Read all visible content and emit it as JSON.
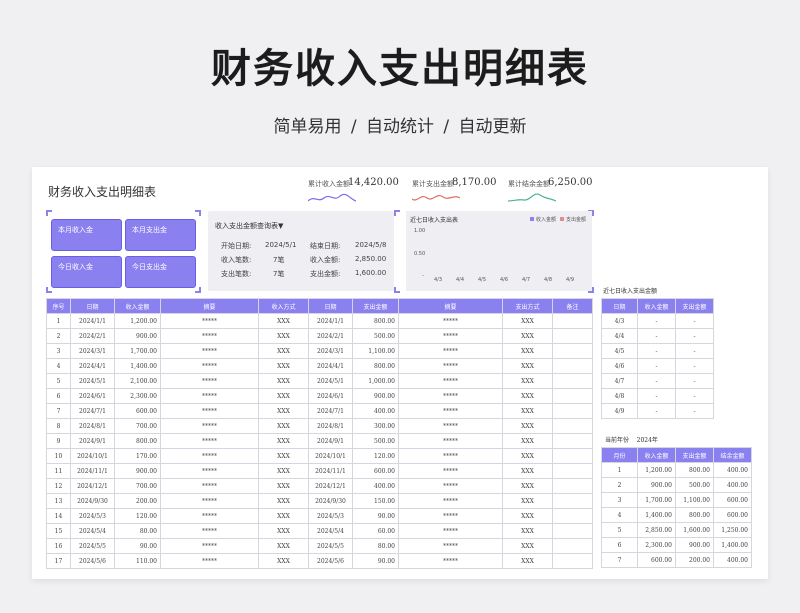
{
  "banner": {
    "title": "财务收入支出明细表",
    "subtitle": "简单易用  /  自动统计  /  自动更新"
  },
  "sheet": {
    "title": "财务收入支出明细表"
  },
  "stats": [
    {
      "label": "累计收入金额",
      "value": "14,420.00",
      "color": "#7c6ee6"
    },
    {
      "label": "累计支出金额",
      "value": "8,170.00",
      "color": "#e0706a"
    },
    {
      "label": "累计结余金额",
      "value": "6,250.00",
      "color": "#4fb38e"
    }
  ],
  "cards": [
    "本月收入金",
    "本月支出金",
    "今日收入金",
    "今日支出金"
  ],
  "query": {
    "title": "收入支出金额查询表▼",
    "start_label": "开始日期:",
    "start_value": "2024/5/1",
    "end_label": "结束日期:",
    "end_value": "2024/5/8",
    "in_count_label": "收入笔数:",
    "in_count_value": "7笔",
    "in_amount_label": "收入金额:",
    "in_amount_value": "2,850.00",
    "out_count_label": "支出笔数:",
    "out_count_value": "7笔",
    "out_amount_label": "支出金额:",
    "out_amount_value": "1,600.00"
  },
  "chart_data": {
    "type": "bar",
    "title": "近七日收入支出表",
    "categories": [
      "4/3",
      "4/4",
      "4/5",
      "4/6",
      "4/7",
      "4/8",
      "4/9"
    ],
    "series": [
      {
        "name": "收入金额",
        "values": [
          0,
          0,
          0,
          0,
          0,
          0,
          0
        ]
      },
      {
        "name": "支出金额",
        "values": [
          0,
          0,
          0,
          0,
          0,
          0,
          0
        ]
      }
    ],
    "y_ticks": [
      "1.00",
      "0.50",
      "-"
    ],
    "ylim": [
      0,
      1
    ]
  },
  "main_table": {
    "headers": [
      "序号",
      "日期",
      "收入金额",
      "摘要",
      "收入方式",
      "日期",
      "支出金额",
      "摘要",
      "支出方式",
      "备注"
    ],
    "rows": [
      [
        "1",
        "2024/1/1",
        "1,200.00",
        "*****",
        "XXX",
        "2024/1/1",
        "800.00",
        "*****",
        "XXX",
        ""
      ],
      [
        "2",
        "2024/2/1",
        "900.00",
        "*****",
        "XXX",
        "2024/2/1",
        "500.00",
        "*****",
        "XXX",
        ""
      ],
      [
        "3",
        "2024/3/1",
        "1,700.00",
        "*****",
        "XXX",
        "2024/3/1",
        "1,100.00",
        "*****",
        "XXX",
        ""
      ],
      [
        "4",
        "2024/4/1",
        "1,400.00",
        "*****",
        "XXX",
        "2024/4/1",
        "800.00",
        "*****",
        "XXX",
        ""
      ],
      [
        "5",
        "2024/5/1",
        "2,100.00",
        "*****",
        "XXX",
        "2024/5/1",
        "1,000.00",
        "*****",
        "XXX",
        ""
      ],
      [
        "6",
        "2024/6/1",
        "2,300.00",
        "*****",
        "XXX",
        "2024/6/1",
        "900.00",
        "*****",
        "XXX",
        ""
      ],
      [
        "7",
        "2024/7/1",
        "600.00",
        "*****",
        "XXX",
        "2024/7/1",
        "400.00",
        "*****",
        "XXX",
        ""
      ],
      [
        "8",
        "2024/8/1",
        "700.00",
        "*****",
        "XXX",
        "2024/8/1",
        "300.00",
        "*****",
        "XXX",
        ""
      ],
      [
        "9",
        "2024/9/1",
        "800.00",
        "*****",
        "XXX",
        "2024/9/1",
        "500.00",
        "*****",
        "XXX",
        ""
      ],
      [
        "10",
        "2024/10/1",
        "170.00",
        "*****",
        "XXX",
        "2024/10/1",
        "120.00",
        "*****",
        "XXX",
        ""
      ],
      [
        "11",
        "2024/11/1",
        "900.00",
        "*****",
        "XXX",
        "2024/11/1",
        "600.00",
        "*****",
        "XXX",
        ""
      ],
      [
        "12",
        "2024/12/1",
        "700.00",
        "*****",
        "XXX",
        "2024/12/1",
        "400.00",
        "*****",
        "XXX",
        ""
      ],
      [
        "13",
        "2024/9/30",
        "200.00",
        "*****",
        "XXX",
        "2024/9/30",
        "150.00",
        "*****",
        "XXX",
        ""
      ],
      [
        "14",
        "2024/5/3",
        "120.00",
        "*****",
        "XXX",
        "2024/5/3",
        "90.00",
        "*****",
        "XXX",
        ""
      ],
      [
        "15",
        "2024/5/4",
        "80.00",
        "*****",
        "XXX",
        "2024/5/4",
        "60.00",
        "*****",
        "XXX",
        ""
      ],
      [
        "16",
        "2024/5/5",
        "90.00",
        "*****",
        "XXX",
        "2024/5/5",
        "80.00",
        "*****",
        "XXX",
        ""
      ],
      [
        "17",
        "2024/5/6",
        "110.00",
        "*****",
        "XXX",
        "2024/5/6",
        "90.00",
        "*****",
        "XXX",
        ""
      ]
    ]
  },
  "week_table": {
    "title": "近七日收入支出金额",
    "headers": [
      "日期",
      "收入金额",
      "支出金额"
    ],
    "rows": [
      [
        "4/3",
        "-",
        "-"
      ],
      [
        "4/4",
        "-",
        "-"
      ],
      [
        "4/5",
        "-",
        "-"
      ],
      [
        "4/6",
        "-",
        "-"
      ],
      [
        "4/7",
        "-",
        "-"
      ],
      [
        "4/8",
        "-",
        "-"
      ],
      [
        "4/9",
        "-",
        "-"
      ]
    ]
  },
  "month_table": {
    "year_label": "当前年份",
    "year_value": "2024年",
    "headers": [
      "月份",
      "收入金额",
      "支出金额",
      "结余金额"
    ],
    "rows": [
      [
        "1",
        "1,200.00",
        "800.00",
        "400.00"
      ],
      [
        "2",
        "900.00",
        "500.00",
        "400.00"
      ],
      [
        "3",
        "1,700.00",
        "1,100.00",
        "600.00"
      ],
      [
        "4",
        "1,400.00",
        "800.00",
        "600.00"
      ],
      [
        "5",
        "2,850.00",
        "1,600.00",
        "1,250.00"
      ],
      [
        "6",
        "2,300.00",
        "900.00",
        "1,400.00"
      ],
      [
        "7",
        "600.00",
        "200.00",
        "400.00"
      ]
    ]
  }
}
